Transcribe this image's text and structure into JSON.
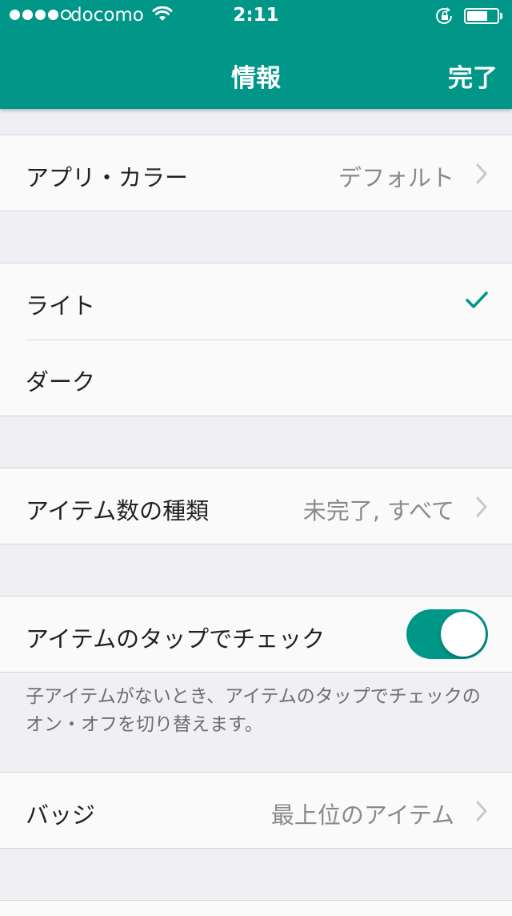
{
  "status_bar": {
    "carrier": "docomo",
    "time": "2:11",
    "signal_bars_filled": 4,
    "signal_bars_total": 5,
    "battery_level": 0.7
  },
  "nav": {
    "title": "情報",
    "done_label": "完了"
  },
  "settings": {
    "app_color": {
      "label": "アプリ・カラー",
      "value": "デフォルト"
    },
    "theme_options": [
      {
        "label": "ライト",
        "selected": true
      },
      {
        "label": "ダーク",
        "selected": false
      }
    ],
    "item_count_type": {
      "label": "アイテム数の種類",
      "value": "未完了, すべて"
    },
    "tap_to_check": {
      "label": "アイテムのタップでチェック",
      "enabled": true,
      "footnote": "子アイテムがないとき、アイテムのタップでチェックのオン・オフを切り替えます。"
    },
    "badge": {
      "label": "バッジ",
      "value": "最上位のアイテム"
    }
  },
  "colors": {
    "accent": "#009688",
    "background": "#efeff4",
    "cell": "#fafafa",
    "secondary_text": "#8a8a8e"
  },
  "icons": [
    "wifi-icon",
    "rotation-lock-icon",
    "battery-icon",
    "chevron-right-icon",
    "checkmark-icon"
  ]
}
